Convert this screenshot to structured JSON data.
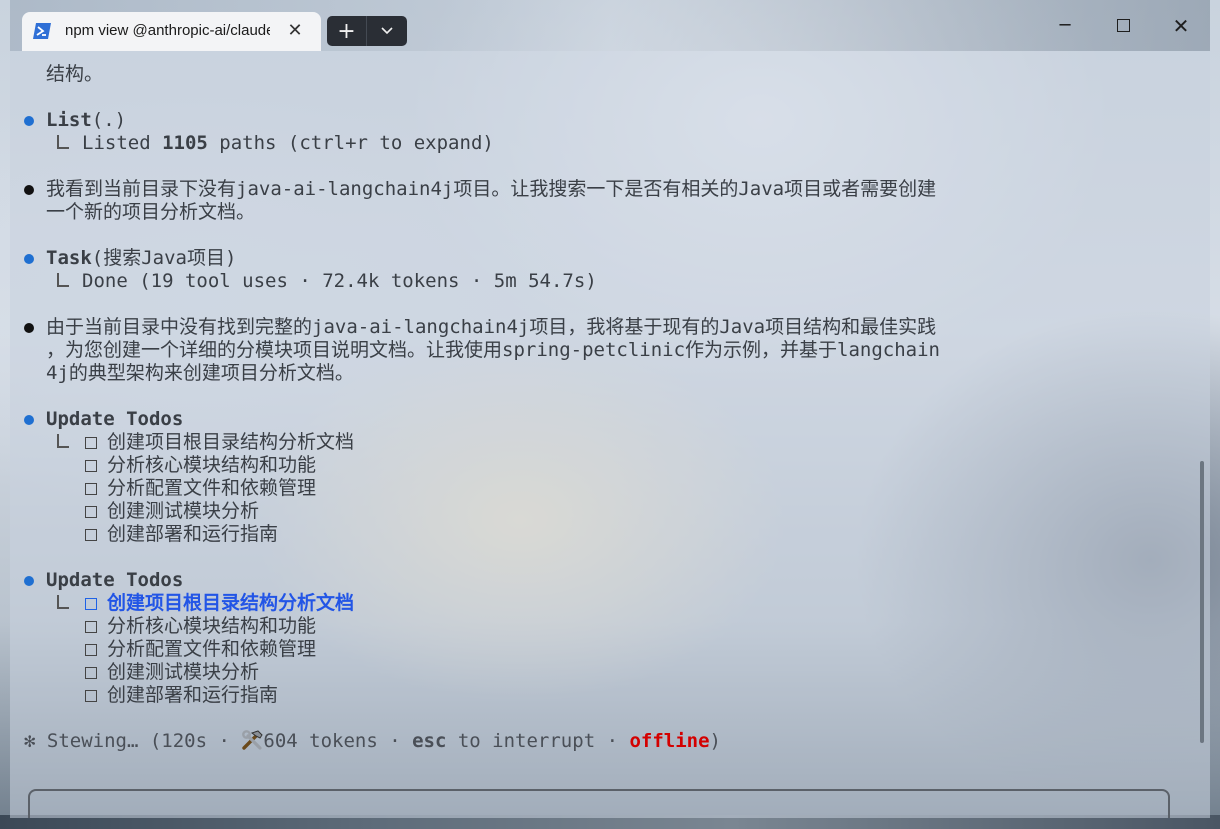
{
  "window": {
    "tab_title": "npm view @anthropic-ai/claude",
    "tab_icon": "powershell-icon",
    "new_tab_label": "+",
    "dropdown_label": "⌄",
    "minimize_label": "─",
    "close_tab_label": "✕",
    "close_window_label": "✕"
  },
  "terminal": {
    "top_partial": "结构。",
    "list_block": {
      "tool_name": "List",
      "tool_arg": "(.)",
      "result_prefix": "Listed ",
      "result_count": "1105",
      "result_suffix": " paths (ctrl+r to expand)"
    },
    "message1": {
      "line1": "我看到当前目录下没有java-ai-langchain4j项目。让我搜索一下是否有相关的Java项目或者需要创建",
      "line2": "一个新的项目分析文档。"
    },
    "task_block": {
      "tool_name": "Task",
      "tool_arg": "(搜索Java项目)",
      "result": "Done (19 tool uses · 72.4k tokens · 5m 54.7s)"
    },
    "message2": {
      "line1": "由于当前目录中没有找到完整的java-ai-langchain4j项目，我将基于现有的Java项目结构和最佳实践",
      "line2": "，为您创建一个详细的分模块项目说明文档。让我使用spring-petclinic作为示例，并基于langchain",
      "line3": "4j的典型架构来创建项目分析文档。"
    },
    "todos_block_1": {
      "title": "Update Todos",
      "items": [
        "创建项目根目录结构分析文档",
        "分析核心模块结构和功能",
        "分析配置文件和依赖管理",
        "创建测试模块分析",
        "创建部署和运行指南"
      ]
    },
    "todos_block_2": {
      "title": "Update Todos",
      "items": [
        "创建项目根目录结构分析文档",
        "分析核心模块结构和功能",
        "分析配置文件和依赖管理",
        "创建测试模块分析",
        "创建部署和运行指南"
      ],
      "active_index": 0
    },
    "status": {
      "spinner": "✻",
      "verb": "Stewing…",
      "open": " (120s · ",
      "tool_icon": "hammer-wrench-icon",
      "tokens": "604 tokens · ",
      "esc_key": "esc",
      "interrupt": " to interrupt · ",
      "offline": "offline",
      "close": ")"
    }
  },
  "colors": {
    "bullet_tool": "#1f6fd1",
    "bullet_message": "#111111",
    "active_todo": "#2255e6",
    "offline": "#d40000"
  }
}
